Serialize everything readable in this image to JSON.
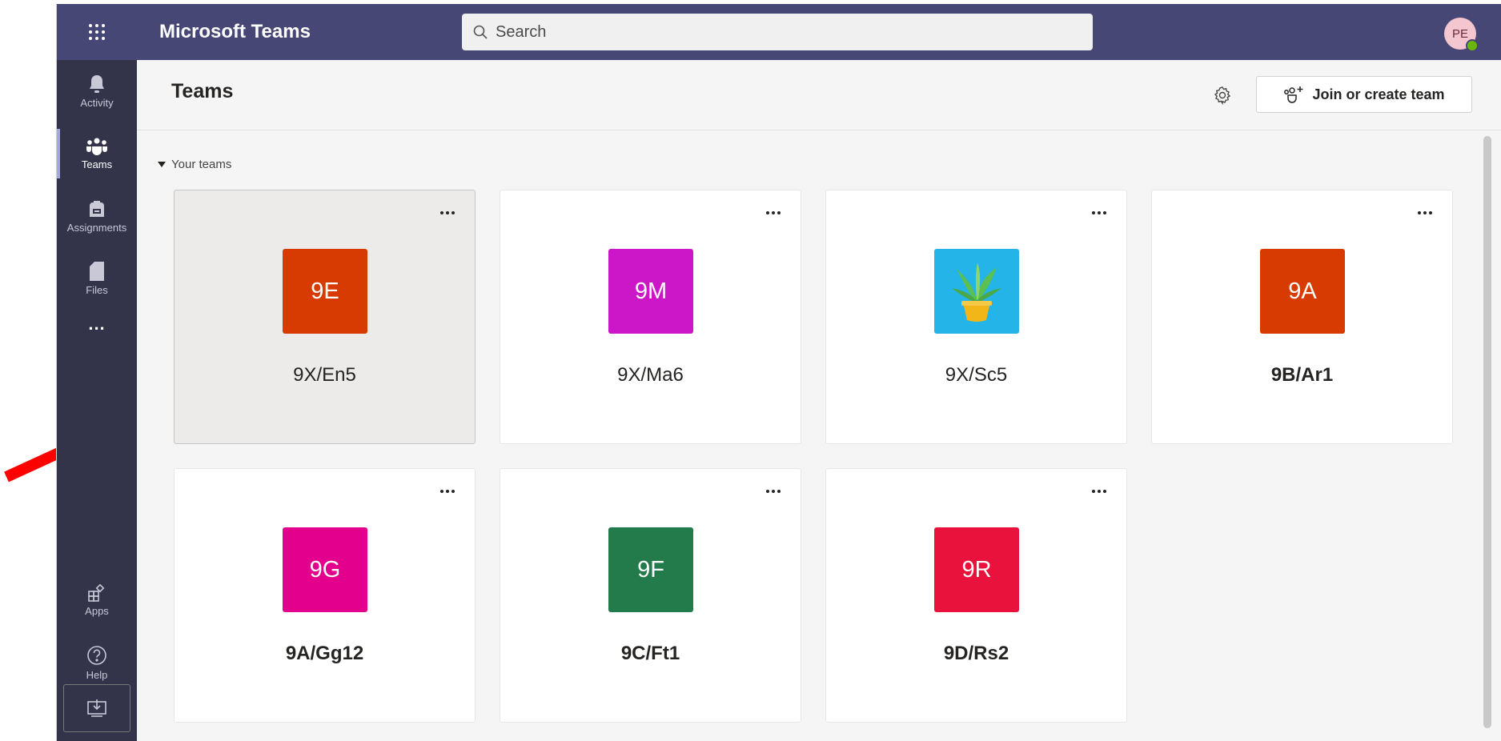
{
  "app": {
    "title": "Microsoft Teams"
  },
  "search": {
    "placeholder": "Search"
  },
  "user": {
    "initials": "PE",
    "presence": "available"
  },
  "rail": {
    "items": [
      {
        "label": "Activity",
        "icon": "bell-icon"
      },
      {
        "label": "Teams",
        "icon": "teams-icon",
        "active": true
      },
      {
        "label": "Assignments",
        "icon": "backpack-icon"
      },
      {
        "label": "Files",
        "icon": "file-icon"
      },
      {
        "label": "...",
        "icon": "more-icon"
      }
    ],
    "bottom_items": [
      {
        "label": "Apps",
        "icon": "apps-icon"
      },
      {
        "label": "Help",
        "icon": "help-icon"
      }
    ]
  },
  "header": {
    "title": "Teams",
    "join_label": "Join or create team"
  },
  "section": {
    "label": "Your teams"
  },
  "teams": [
    {
      "initials": "9E",
      "name": "9X/En5",
      "color": "#d83b01",
      "bold": false
    },
    {
      "initials": "9M",
      "name": "9X/Ma6",
      "color": "#cc17c8",
      "bold": false
    },
    {
      "initials": "",
      "name": "9X/Sc5",
      "color": "#24b4e8",
      "bold": false,
      "image": "plant-icon"
    },
    {
      "initials": "9A",
      "name": "9B/Ar1",
      "color": "#d83b01",
      "bold": true
    },
    {
      "initials": "9G",
      "name": "9A/Gg12",
      "color": "#e3008c",
      "bold": true
    },
    {
      "initials": "9F",
      "name": "9C/Ft1",
      "color": "#237b4b",
      "bold": true
    },
    {
      "initials": "9R",
      "name": "9D/Rs2",
      "color": "#e8123c",
      "bold": true
    }
  ],
  "colors": {
    "topbar": "#464775",
    "rail": "#33344a",
    "arrow": "#ff0000"
  }
}
